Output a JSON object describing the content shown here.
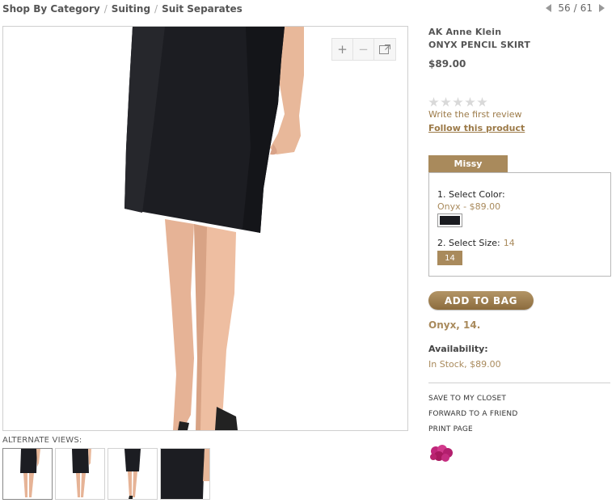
{
  "breadcrumb": {
    "items": [
      "Shop By Category",
      "Suiting",
      "Suit Separates"
    ],
    "separator": "/"
  },
  "pager": {
    "current": "56",
    "separator": "/",
    "total": "61"
  },
  "zoom": {
    "in": "+",
    "out": "−"
  },
  "alternate_views": {
    "label": "ALTERNATE VIEWS:",
    "count": 4
  },
  "product": {
    "brand": "AK Anne Klein",
    "name": "ONYX PENCIL SKIRT",
    "price": "$89.00",
    "rating_stars": 5,
    "review_link": "Write the first review",
    "follow_link": "Follow this product"
  },
  "options": {
    "size_tab": "Missy",
    "step1_label": "1. Select Color:",
    "color_value": "Onyx - $89.00",
    "swatch_color": "#1a1b20",
    "step2_label": "2. Select Size:",
    "size_value": "14",
    "size_button": "14"
  },
  "cart": {
    "add_button": "ADD TO BAG",
    "selection": "Onyx, 14.",
    "availability_label": "Availability:",
    "availability_value": "In Stock, $89.00"
  },
  "actions": [
    "SAVE TO MY CLOSET",
    "FORWARD TO A FRIEND",
    "PRINT PAGE"
  ],
  "colors": {
    "accent": "#a98a5c",
    "link": "#9c7a48",
    "garment": "#1a1b20"
  }
}
